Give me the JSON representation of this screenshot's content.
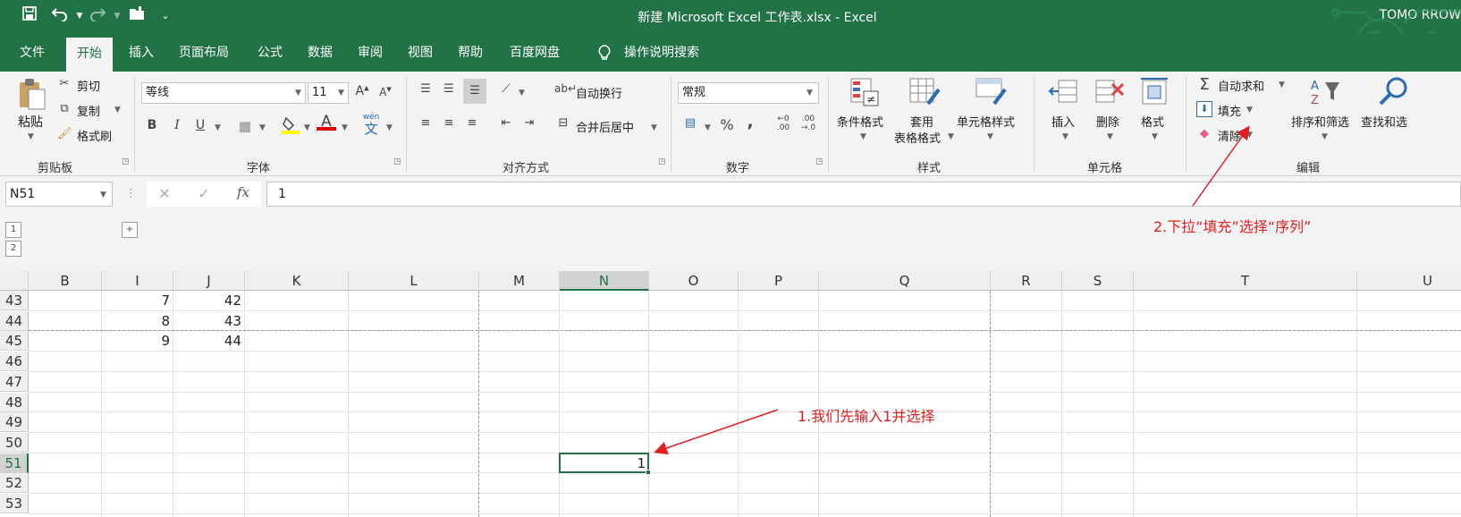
{
  "title_bar": {
    "title": "新建 Microsoft Excel 工作表.xlsx  -  Excel",
    "user": "TOMO RROW"
  },
  "menu": {
    "tabs": [
      "文件",
      "开始",
      "插入",
      "页面布局",
      "公式",
      "数据",
      "审阅",
      "视图",
      "帮助",
      "百度网盘"
    ],
    "active_tab": "开始",
    "search_hint": "操作说明搜索"
  },
  "ribbon": {
    "clipboard": {
      "paste": "粘贴",
      "cut": "剪切",
      "copy": "复制",
      "format_painter": "格式刷",
      "group": "剪贴板"
    },
    "font": {
      "name": "等线",
      "size": "11",
      "bold": "B",
      "italic": "I",
      "underline": "U",
      "wen": "wén",
      "wen_char": "文",
      "group": "字体"
    },
    "alignment": {
      "wrap": "自动换行",
      "merge": "合并后居中",
      "group": "对齐方式"
    },
    "number": {
      "format": "常规",
      "percent": "%",
      "comma": ",",
      "inc_decimal_top": "←0",
      "inc_decimal_bottom": ".00",
      "dec_decimal_top": ".00",
      "dec_decimal_bottom": "→.0",
      "group": "数字"
    },
    "styles": {
      "conditional": "条件格式",
      "table_1": "套用",
      "table_2": "表格格式",
      "cell_styles": "单元格样式",
      "group": "样式"
    },
    "cells": {
      "insert": "插入",
      "delete": "删除",
      "format": "格式",
      "group": "单元格"
    },
    "editing": {
      "autosum": "自动求和",
      "fill": "填充",
      "clear": "清除",
      "sort_filter": "排序和筛选",
      "find_select": "查找和选",
      "group": "编辑"
    }
  },
  "formula_bar": {
    "name_box": "N51",
    "fx": "fx",
    "value": "1"
  },
  "outline": {
    "levels": [
      "1",
      "2"
    ],
    "expand": "+"
  },
  "sheet": {
    "columns": [
      {
        "label": "B",
        "selected": false
      },
      {
        "label": "I",
        "selected": false
      },
      {
        "label": "J",
        "selected": false
      },
      {
        "label": "K",
        "selected": false
      },
      {
        "label": "L",
        "selected": false
      },
      {
        "label": "M",
        "selected": false
      },
      {
        "label": "N",
        "selected": true
      },
      {
        "label": "O",
        "selected": false
      },
      {
        "label": "P",
        "selected": false
      },
      {
        "label": "Q",
        "selected": false
      },
      {
        "label": "R",
        "selected": false
      },
      {
        "label": "S",
        "selected": false
      },
      {
        "label": "T",
        "selected": false
      },
      {
        "label": "U",
        "selected": false
      }
    ],
    "rows": [
      "43",
      "44",
      "45",
      "46",
      "47",
      "48",
      "49",
      "50",
      "51",
      "52",
      "53"
    ],
    "selected_row": "51",
    "active_cell": "N51",
    "cells": [
      {
        "ref": "I43",
        "value": "7"
      },
      {
        "ref": "J43",
        "value": "42"
      },
      {
        "ref": "I44",
        "value": "8"
      },
      {
        "ref": "J44",
        "value": "43"
      },
      {
        "ref": "I45",
        "value": "9"
      },
      {
        "ref": "J45",
        "value": "44"
      },
      {
        "ref": "N51",
        "value": "1"
      }
    ]
  },
  "annotations": {
    "step1": "1.我们先输入1并选择",
    "step2": "2.下拉“填充”选择“序列”"
  },
  "colors": {
    "accent": "#217346",
    "annotation": "#e02020"
  }
}
